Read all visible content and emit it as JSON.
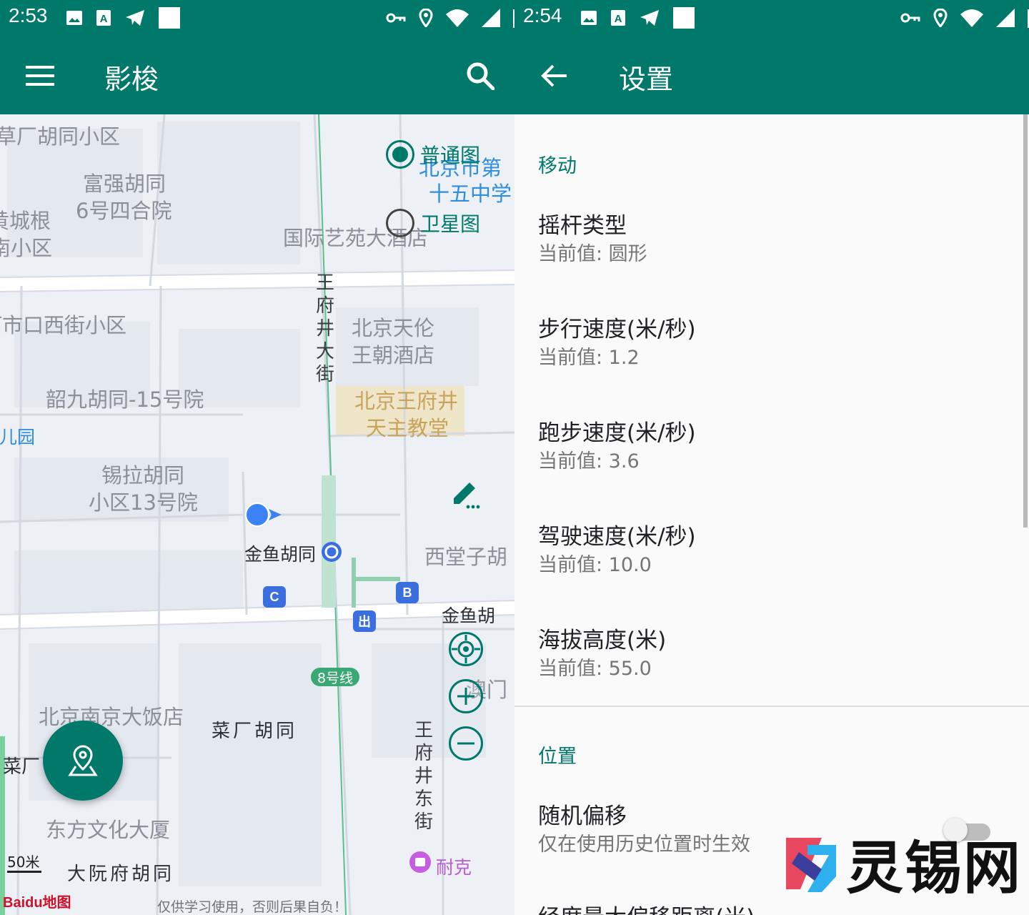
{
  "left": {
    "status": {
      "time": "2:53"
    },
    "toolbar": {
      "title": "影梭"
    },
    "map": {
      "layer_options": [
        {
          "label": "普通图",
          "selected": true
        },
        {
          "label": "卫星图",
          "selected": false
        }
      ],
      "labels": {
        "l1": "草厂胡同小区",
        "l2": "富强胡同",
        "l3": "6号四合院",
        "l4": "黄城根",
        "l5": "南小区",
        "l6": "北京市第",
        "l7": "十五中学",
        "l8": "国际艺苑大酒店",
        "l9": "灯市口西街小区",
        "l10": "北京天伦",
        "l11": "王朝酒店",
        "l12": "韶九胡同-15号院",
        "l13": "北京王府井",
        "l14": "天主教堂",
        "l15": "幼儿园",
        "l16": "锡拉胡同",
        "l17": "小区13号院",
        "l18": "金鱼胡同",
        "l19": "西堂子胡",
        "l20": "金鱼胡",
        "l21": "澳门",
        "l22": "北京南京大饭店",
        "l23": "菜厂胡同",
        "l24": "菜厂",
        "l25": "东方文化大厦",
        "l26": "大阮府胡同",
        "l27": "耐克"
      },
      "street_v1": "王府井大街",
      "street_v2": "王府井东街",
      "badges": {
        "b": "B",
        "c": "C",
        "exit": "出"
      },
      "metro_line": "8号线",
      "scale": "50米",
      "logo": "Baidu地图",
      "disclaimer": "仅供学习使用，否则后果自负！"
    }
  },
  "right": {
    "status": {
      "time": "2:54"
    },
    "toolbar": {
      "title": "设置"
    },
    "sections": [
      {
        "header": "移动",
        "items": [
          {
            "title": "摇杆类型",
            "summary": "当前值: 圆形"
          },
          {
            "title": "步行速度(米/秒)",
            "summary": "当前值: 1.2"
          },
          {
            "title": "跑步速度(米/秒)",
            "summary": "当前值: 3.6"
          },
          {
            "title": "驾驶速度(米/秒)",
            "summary": "当前值: 10.0"
          },
          {
            "title": "海拔高度(米)",
            "summary": "当前值: 55.0"
          }
        ]
      },
      {
        "header": "位置",
        "items": [
          {
            "title": "随机偏移",
            "summary": "仅在使用历史位置时生效",
            "toggle": false
          },
          {
            "title": "经度最大偏移距离(米)"
          }
        ]
      }
    ],
    "watermark": "灵锡网"
  },
  "colors": {
    "primary": "#00796b",
    "location_dot": "#3b82f6"
  }
}
